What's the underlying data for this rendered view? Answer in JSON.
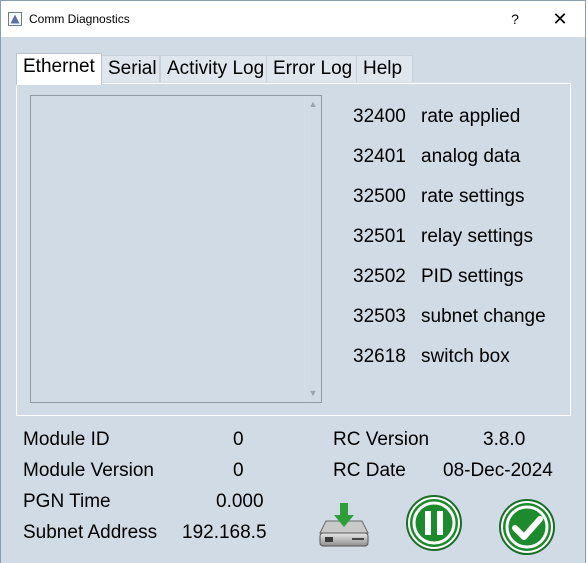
{
  "window": {
    "title": "Comm Diagnostics",
    "help_glyph": "?",
    "close_glyph": "✕"
  },
  "tabs": [
    {
      "label": "Ethernet",
      "active": true
    },
    {
      "label": "Serial",
      "active": false
    },
    {
      "label": "Activity Log",
      "active": false
    },
    {
      "label": "Error Log",
      "active": false
    },
    {
      "label": "Help",
      "active": false
    }
  ],
  "pgns": [
    {
      "number": "32400",
      "desc": "rate applied"
    },
    {
      "number": "32401",
      "desc": "analog data"
    },
    {
      "number": "32500",
      "desc": "rate settings"
    },
    {
      "number": "32501",
      "desc": "relay settings"
    },
    {
      "number": "32502",
      "desc": "PID settings"
    },
    {
      "number": "32503",
      "desc": "subnet change"
    },
    {
      "number": "32618",
      "desc": "switch box"
    }
  ],
  "info_left": {
    "module_id_label": "Module ID",
    "module_id_value": "0",
    "module_version_label": "Module Version",
    "module_version_value": "0",
    "pgn_time_label": "PGN Time",
    "pgn_time_value": "0.000",
    "subnet_label": "Subnet Address",
    "subnet_value": "192.168.5"
  },
  "info_right": {
    "rc_version_label": "RC Version",
    "rc_version_value": "3.8.0",
    "rc_date_label": "RC Date",
    "rc_date_value": "08-Dec-2024"
  },
  "buttons": {
    "save_icon": "save-to-drive-icon",
    "pause_icon": "pause-icon",
    "ok_icon": "checkmark-icon"
  },
  "colors": {
    "window_bg": "#d1dbe5",
    "green_button": "#1e8a2e",
    "green_button_light": "#3ab54a"
  }
}
